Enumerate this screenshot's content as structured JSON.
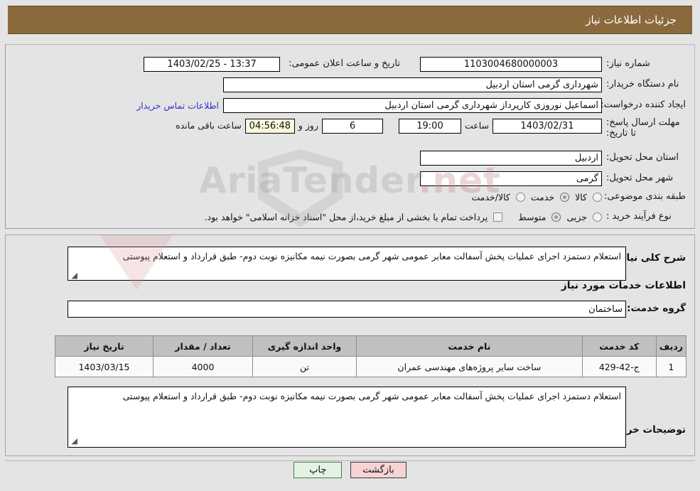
{
  "header": {
    "title": "جزئیات اطلاعات نیاز"
  },
  "form": {
    "need_number_label": "شماره نیاز:",
    "need_number_value": "1103004680000003",
    "announce_label": "تاریخ و ساعت اعلان عمومی:",
    "announce_value": "13:37 - 1403/02/25",
    "buyer_org_label": "نام دستگاه خریدار:",
    "buyer_org_value": "شهرداری گرمی استان اردبیل",
    "creator_label": "ایجاد کننده درخواست:",
    "creator_value": "اسماعیل نوروزی کارپرداز شهرداری گرمی استان اردبیل",
    "contact_link": "اطلاعات تماس خریدار",
    "deadline_label": "مهلت ارسال پاسخ: تا تاریخ:",
    "deadline_date": "1403/02/31",
    "hour_label": "ساعت",
    "deadline_time": "19:00",
    "days_remaining": "6",
    "days_word": "روز و",
    "countdown": "04:56:48",
    "remaining_label": "ساعت باقی مانده",
    "province_label": "استان محل تحویل:",
    "province_value": "اردبیل",
    "city_label": "شهر محل تحویل:",
    "city_value": "گرمی",
    "category_label": "طبقه بندی موضوعی:",
    "category_options": [
      {
        "label": "کالا",
        "selected": false
      },
      {
        "label": "خدمت",
        "selected": true
      },
      {
        "label": "کالا/خدمت",
        "selected": false
      }
    ],
    "process_label": "نوع فرآیند خرید :",
    "process_options": [
      {
        "label": "جزیی",
        "selected": false
      },
      {
        "label": "متوسط",
        "selected": true
      }
    ],
    "treasury_note": "پرداخت تمام یا بخشی از مبلغ خرید،از محل \"اسناد خزانه اسلامی\" خواهد بود."
  },
  "details": {
    "summary_label": "شرح کلی نیاز:",
    "summary_text": "استعلام دستمزد اجرای عملیات پخش آسفالت معابر عمومی شهر گرمی بصورت نیمه مکانیزه نوبت دوم- طبق قرارداد و استعلام پیوستی",
    "services_heading": "اطلاعات خدمات مورد نیاز",
    "service_group_label": "گروه خدمت:",
    "service_group_value": "ساختمان",
    "buyer_notes_label": "توضیحات خریدار:",
    "buyer_notes_text": "استعلام دستمزد اجرای عملیات پخش آسفالت معابر عمومی شهر گرمی بصورت نیمه مکانیزه نوبت دوم- طبق قرارداد و استعلام پیوستی"
  },
  "table": {
    "columns": [
      "ردیف",
      "کد خدمت",
      "نام خدمت",
      "واحد اندازه گیری",
      "تعداد / مقدار",
      "تاریخ نیاز"
    ],
    "rows": [
      {
        "index": "1",
        "code": "ج-42-429",
        "name": "ساخت سایر پروژه‌های مهندسی عمران",
        "unit": "تن",
        "quantity": "4000",
        "need_date": "1403/03/15"
      }
    ]
  },
  "footer": {
    "print_label": "چاپ",
    "back_label": "بازگشت"
  },
  "watermark": {
    "text": "AriaTender",
    "suffix": ".net"
  },
  "colors": {
    "header_bg": "#8a6a3d",
    "link": "#3333cc",
    "back_btn": "#f6d4d4",
    "print_btn": "#e3f3e3",
    "countdown_bg": "#fbf8dc"
  }
}
